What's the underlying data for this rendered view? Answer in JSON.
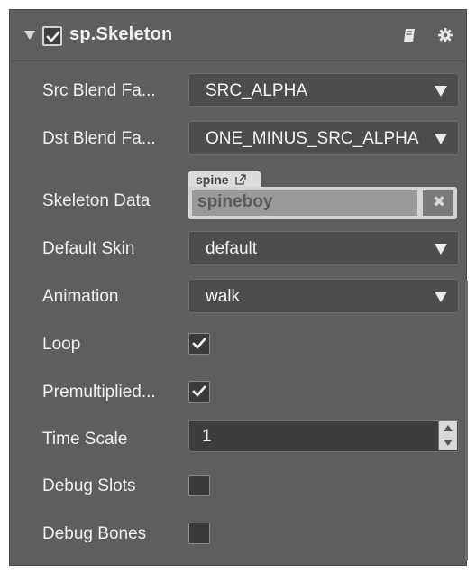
{
  "component": {
    "title": "sp.Skeleton",
    "enabled": true
  },
  "properties": {
    "src_blend": {
      "label": "Src Blend Fa...",
      "value": "SRC_ALPHA"
    },
    "dst_blend": {
      "label": "Dst Blend Fa...",
      "value": "ONE_MINUS_SRC_ALPHA"
    },
    "skeleton_data": {
      "label": "Skeleton Data",
      "asset_type": "spine",
      "value": "spineboy",
      "clear_symbol": "✖"
    },
    "default_skin": {
      "label": "Default Skin",
      "value": "default"
    },
    "animation": {
      "label": "Animation",
      "value": "walk"
    },
    "loop": {
      "label": "Loop",
      "checked": true
    },
    "premultiplied": {
      "label": "Premultiplied...",
      "checked": true
    },
    "time_scale": {
      "label": "Time Scale",
      "value": "1"
    },
    "debug_slots": {
      "label": "Debug Slots",
      "checked": false
    },
    "debug_bones": {
      "label": "Debug Bones",
      "checked": false
    }
  },
  "icons": {
    "fold": "triangle-down-icon",
    "help": "book-icon",
    "settings": "gear-icon"
  }
}
